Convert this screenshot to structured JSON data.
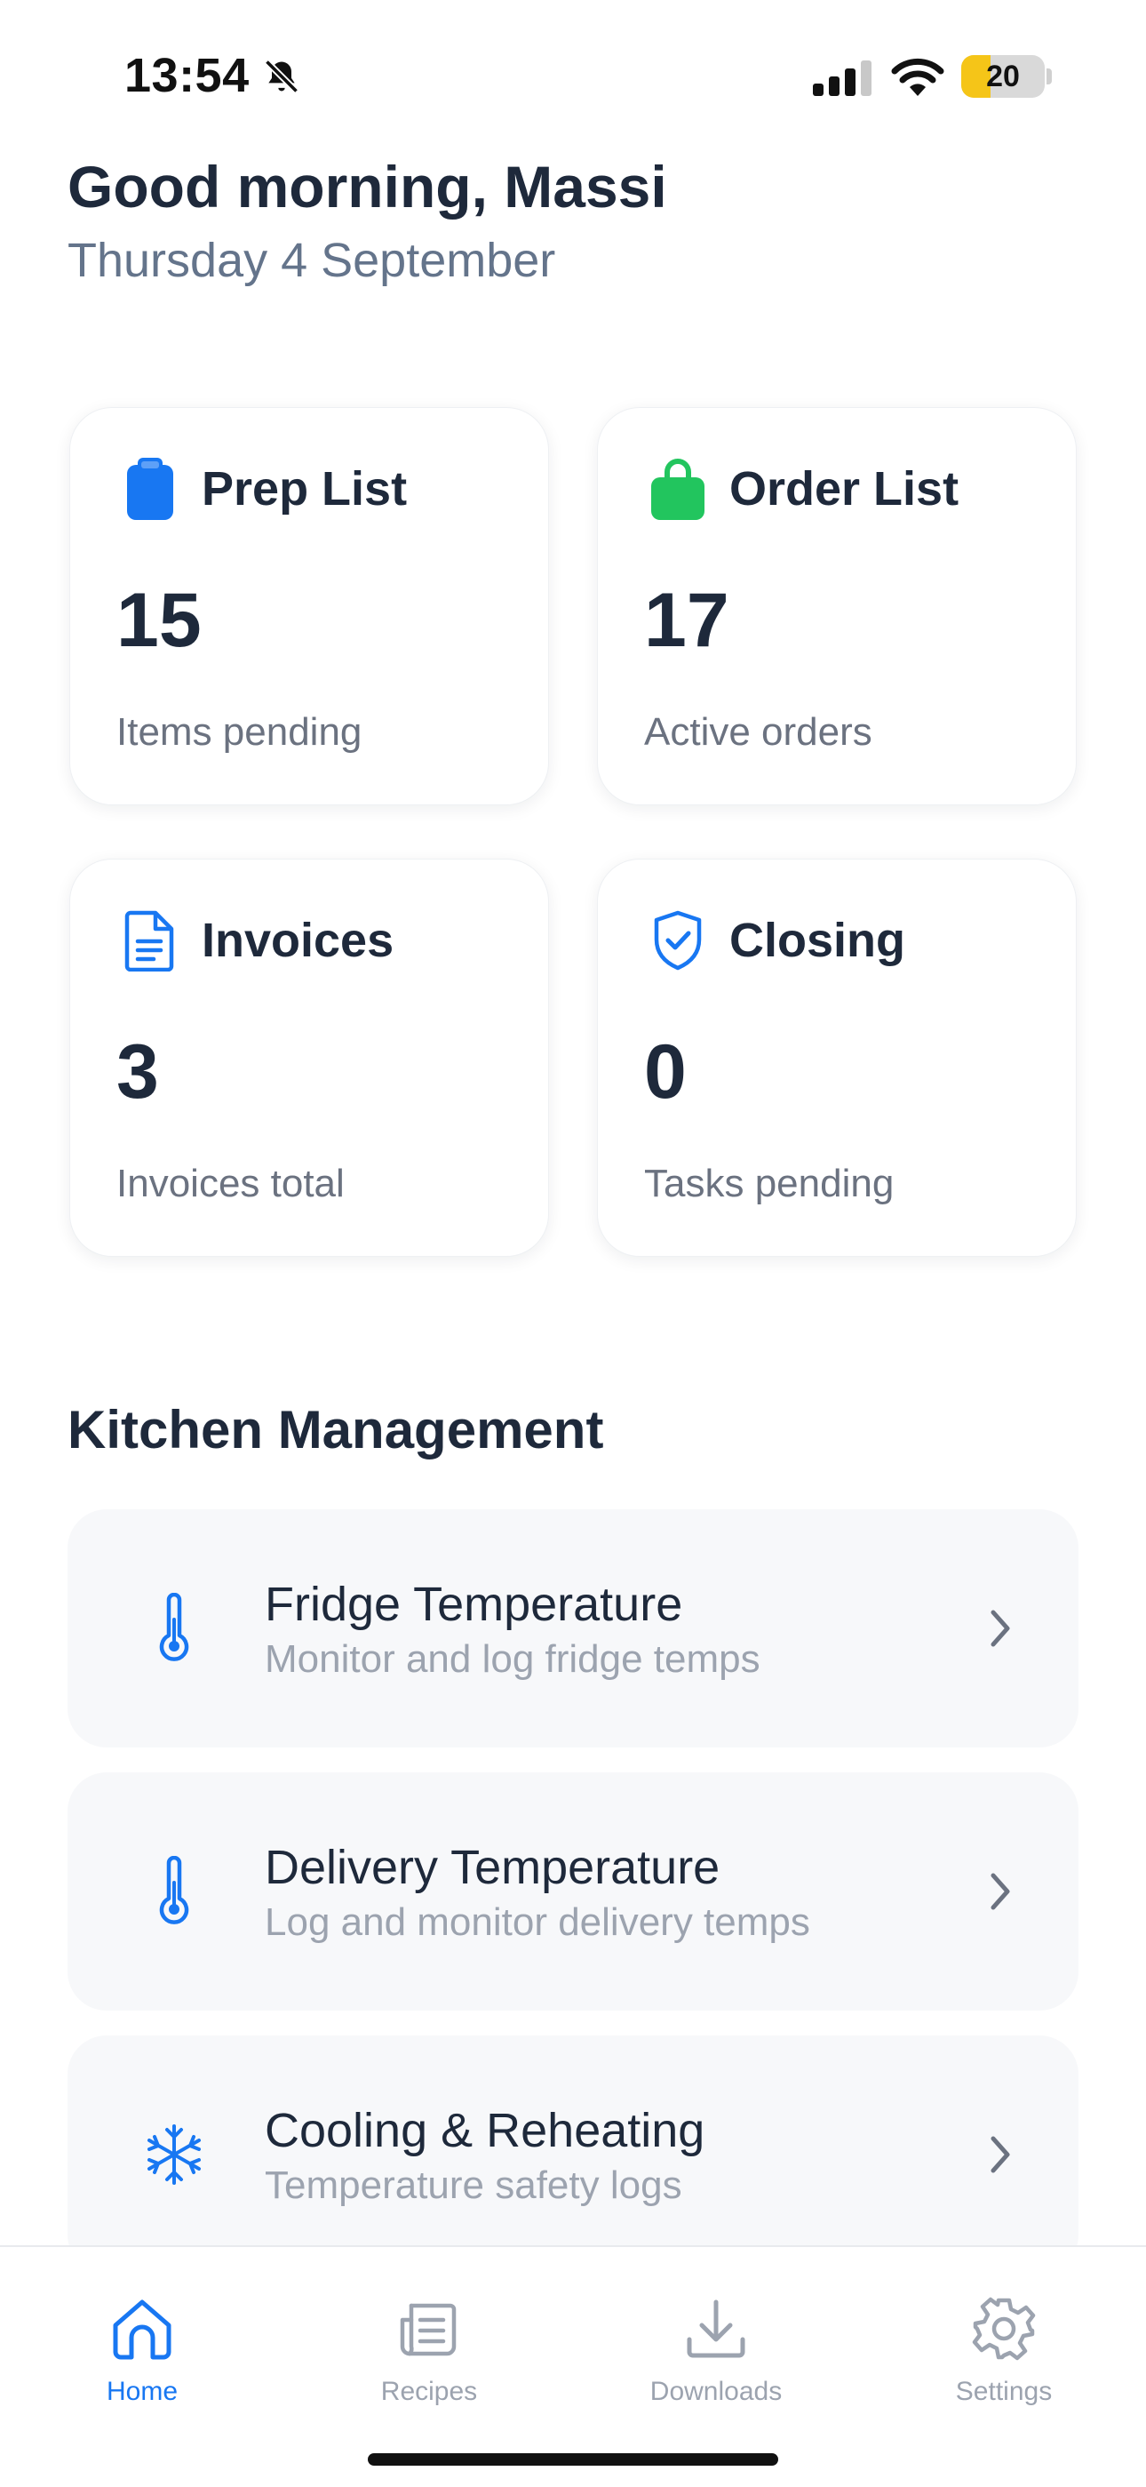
{
  "status_bar": {
    "time": "13:54",
    "battery": "20",
    "battery_level": 0.2
  },
  "header": {
    "greeting": "Good morning, Massi",
    "date": "Thursday 4 September"
  },
  "cards": [
    {
      "icon": "clipboard-icon",
      "title": "Prep List",
      "value": "15",
      "subtitle": "Items pending",
      "color": "#1877f2"
    },
    {
      "icon": "shopping-bag-icon",
      "title": "Order List",
      "value": "17",
      "subtitle": "Active orders",
      "color": "#22c55e"
    },
    {
      "icon": "document-icon",
      "title": "Invoices",
      "value": "3",
      "subtitle": "Invoices total",
      "color": "#1877f2"
    },
    {
      "icon": "shield-check-icon",
      "title": "Closing",
      "value": "0",
      "subtitle": "Tasks pending",
      "color": "#1877f2"
    }
  ],
  "kitchen": {
    "title": "Kitchen Management",
    "items": [
      {
        "icon": "thermometer-icon",
        "title": "Fridge Temperature",
        "subtitle": "Monitor and log fridge temps"
      },
      {
        "icon": "thermometer-icon",
        "title": "Delivery Temperature",
        "subtitle": "Log and monitor delivery temps"
      },
      {
        "icon": "snowflake-icon",
        "title": "Cooling & Reheating",
        "subtitle": "Temperature safety logs"
      }
    ]
  },
  "tabs": [
    {
      "icon": "home-icon",
      "label": "Home",
      "active": true
    },
    {
      "icon": "recipes-icon",
      "label": "Recipes",
      "active": false
    },
    {
      "icon": "download-icon",
      "label": "Downloads",
      "active": false
    },
    {
      "icon": "gear-icon",
      "label": "Settings",
      "active": false
    }
  ],
  "colors": {
    "accent": "#1877f2",
    "green": "#22c55e",
    "text": "#1e293b",
    "muted": "#6b7280"
  }
}
